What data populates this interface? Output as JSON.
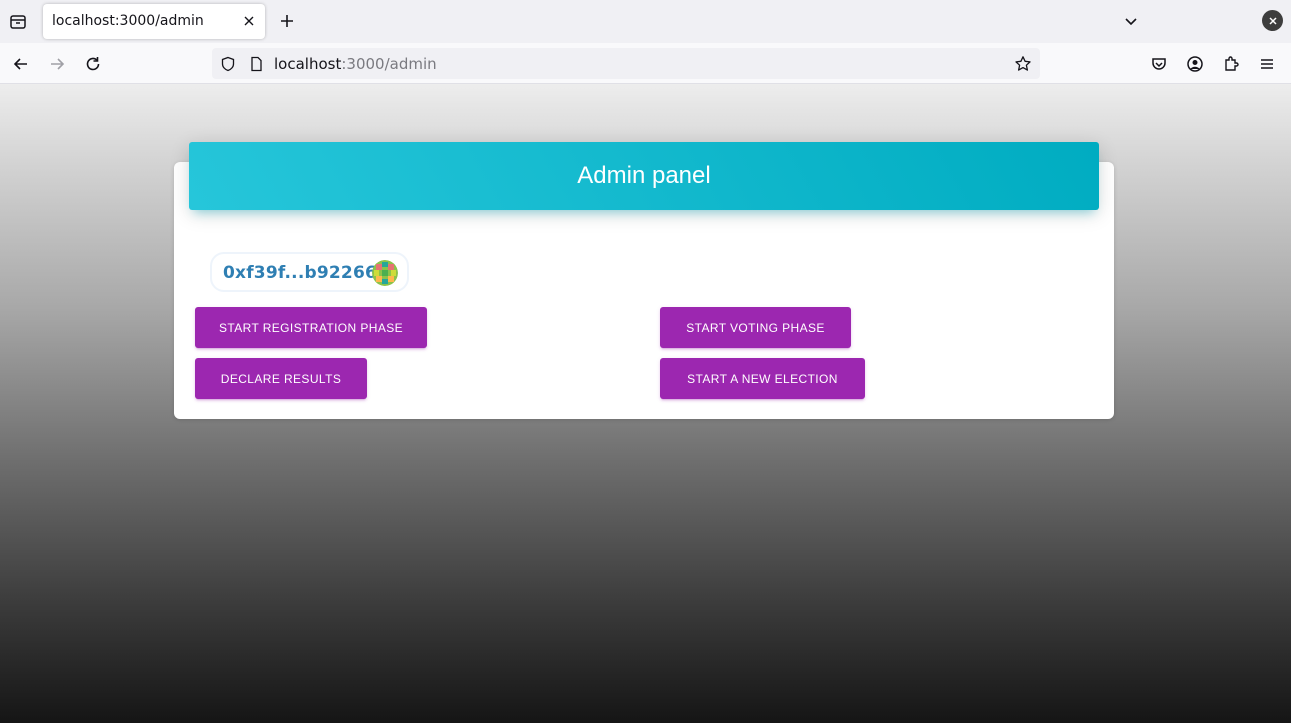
{
  "browser": {
    "tab": {
      "title": "localhost:3000/admin"
    },
    "url": {
      "host": "localhost",
      "path": ":3000/admin"
    }
  },
  "page": {
    "panel_title": "Admin panel",
    "account": {
      "address": "0xf39f...b92266"
    },
    "buttons": {
      "start_registration": "Start Registration Phase",
      "start_voting": "Start Voting Phase",
      "declare_results": "Declare Results",
      "start_new_election": "Start A New Election"
    }
  },
  "colors": {
    "header_gradient_start": "#26c6da",
    "header_gradient_end": "#00acc1",
    "button_primary": "#9c27b0",
    "account_text": "#2f7fb3"
  },
  "icons": [
    "tab-list-icon",
    "close-icon",
    "plus-icon",
    "chevron-down-icon",
    "back-arrow-icon",
    "forward-arrow-icon",
    "reload-icon",
    "shield-icon",
    "page-icon",
    "star-icon",
    "pocket-icon",
    "account-icon",
    "extensions-icon",
    "menu-icon",
    "identicon-avatar"
  ]
}
